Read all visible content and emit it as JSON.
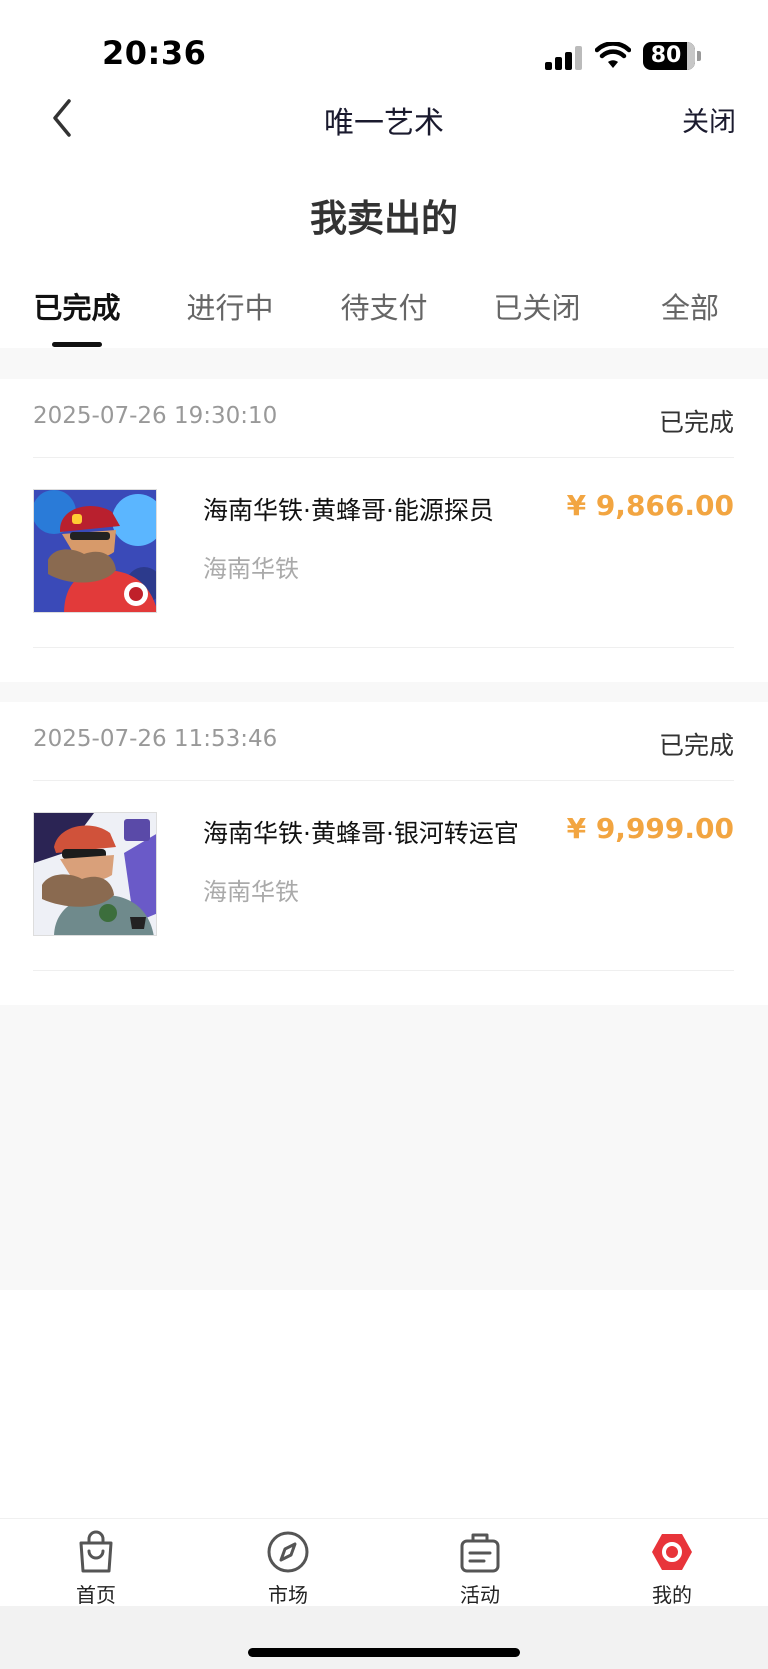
{
  "status_bar": {
    "time": "20:36",
    "battery": "80"
  },
  "header": {
    "title": "唯一艺术",
    "close_label": "关闭"
  },
  "page_title": "我卖出的",
  "tabs": [
    {
      "label": "已完成",
      "active": true
    },
    {
      "label": "进行中",
      "active": false
    },
    {
      "label": "待支付",
      "active": false
    },
    {
      "label": "已关闭",
      "active": false
    },
    {
      "label": "全部",
      "active": false
    }
  ],
  "orders": [
    {
      "date": "2025-07-26 19:30:10",
      "status": "已完成",
      "name": "海南华铁·黄蜂哥·能源探员",
      "shop": "海南华铁",
      "price": "¥ 9,866.00"
    },
    {
      "date": "2025-07-26 11:53:46",
      "status": "已完成",
      "name": "海南华铁·黄蜂哥·银河转运官",
      "shop": "海南华铁",
      "price": "¥ 9,999.00"
    }
  ],
  "tab_bar": [
    {
      "label": "首页",
      "icon": "shopping-bag-icon"
    },
    {
      "label": "市场",
      "icon": "compass-icon"
    },
    {
      "label": "活动",
      "icon": "activity-list-icon"
    },
    {
      "label": "我的",
      "icon": "profile-hexagon-icon"
    }
  ],
  "colors": {
    "price": "#f2a541",
    "accent": "#e8343a",
    "page_bg": "#f8f8f8"
  }
}
